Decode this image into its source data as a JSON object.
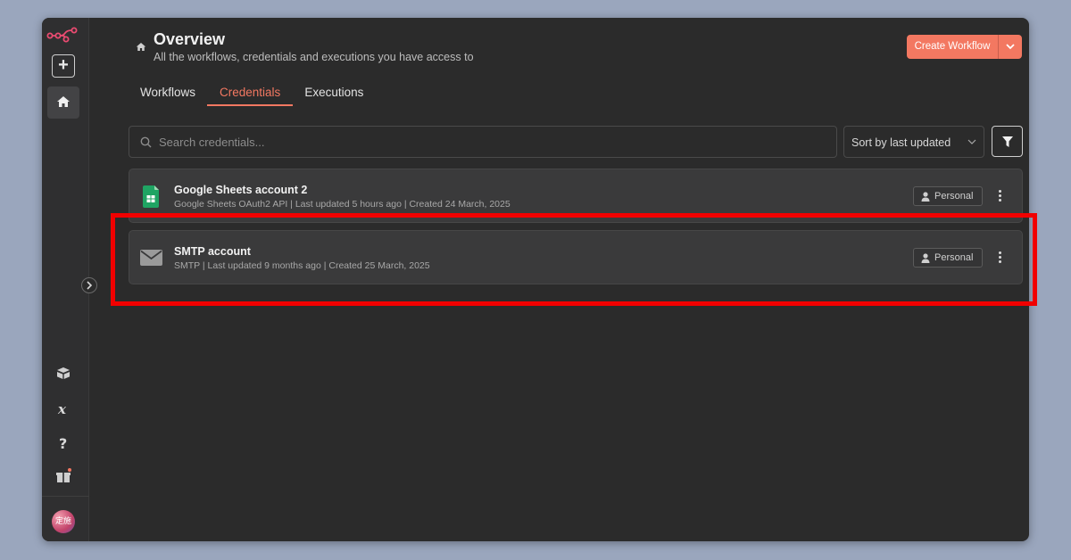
{
  "header": {
    "title": "Overview",
    "subtitle": "All the workflows, credentials and executions you have access to",
    "create_label": "Create Workflow"
  },
  "sidebar": {
    "add_label": "+",
    "avatar_text": "定施"
  },
  "tabs": [
    {
      "label": "Workflows",
      "active": false
    },
    {
      "label": "Credentials",
      "active": true
    },
    {
      "label": "Executions",
      "active": false
    }
  ],
  "search": {
    "placeholder": "Search credentials..."
  },
  "sort": {
    "label": "Sort by last updated"
  },
  "credentials": [
    {
      "name": "Google Sheets account 2",
      "meta": "Google Sheets OAuth2 API | Last updated 5 hours ago | Created 24 March, 2025",
      "badge": "Personal",
      "icon": "google-sheets-icon"
    },
    {
      "name": "SMTP account",
      "meta": "SMTP | Last updated 9 months ago | Created 25 March, 2025",
      "badge": "Personal",
      "icon": "envelope-icon"
    }
  ],
  "colors": {
    "accent": "#f37861",
    "highlight": "#f10000",
    "background": "#2b2b2b"
  }
}
